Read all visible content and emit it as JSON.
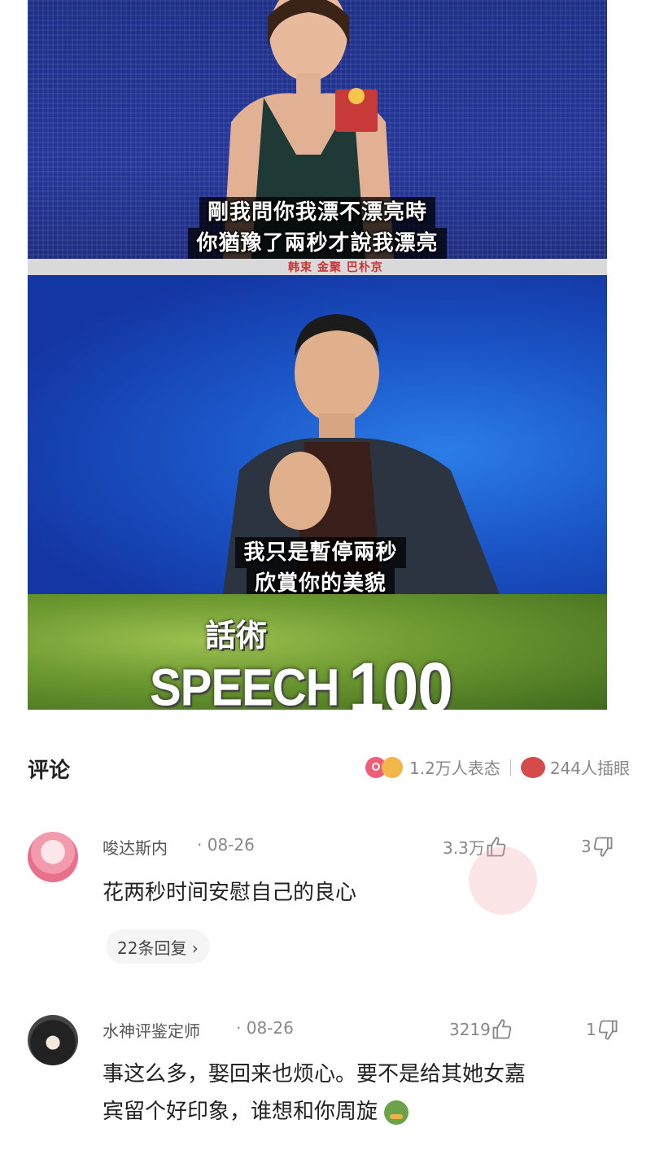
{
  "media": {
    "panel1_subtitle_line1": "剛我問你我漂不漂亮時",
    "panel1_subtitle_line2": "你猶豫了兩秒才說我漂亮",
    "panel1_strip": "韩束 金聚 巴朴京",
    "panel2_subtitle_line1": "我只是暫停兩秒",
    "panel2_subtitle_line2": "欣賞你的美貌",
    "panel3_title": "話術",
    "panel3_speech": "SPEECH",
    "panel3_score": "100"
  },
  "comments_header": {
    "title": "评论",
    "reaction_count": "1.2万人表态",
    "eye_count": "244人插眼",
    "colors": {
      "heart": "#f05d77",
      "accent": "#f2b74a"
    }
  },
  "comments": [
    {
      "username": "唆达斯内",
      "date": "· 08-26",
      "likes": "3.3万",
      "dislikes": "3",
      "text": "花两秒时间安慰自己的良心",
      "replies": "22条回复 ›"
    },
    {
      "username": "水神评鉴定师",
      "date": "· 08-26",
      "likes": "3219",
      "dislikes": "1",
      "text_line1": "事这么多，娶回来也烦心。要不是给其她女嘉",
      "text_line2": "宾留个好印象，谁想和你周旋"
    }
  ]
}
